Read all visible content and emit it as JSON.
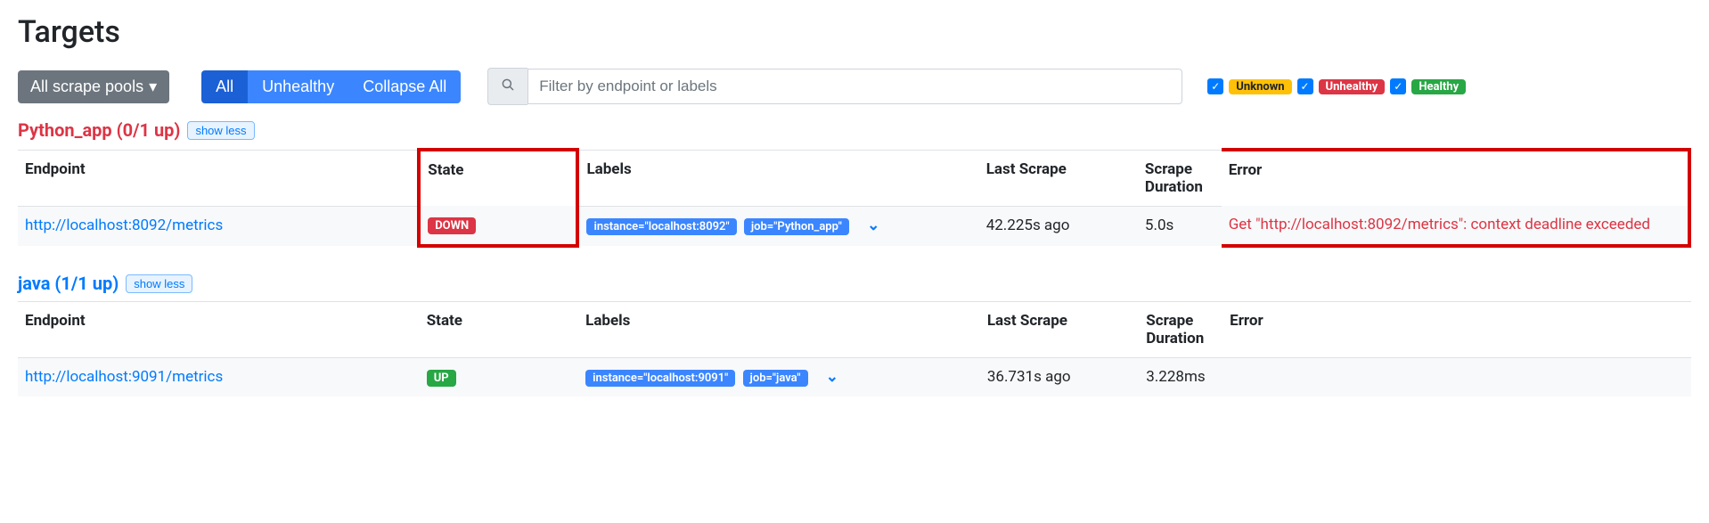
{
  "page_title": "Targets",
  "toolbar": {
    "pools": "All scrape pools",
    "all": "All",
    "unhealthy": "Unhealthy",
    "collapse": "Collapse All",
    "search_placeholder": "Filter by endpoint or labels"
  },
  "legend": {
    "unknown": "Unknown",
    "unhealthy": "Unhealthy",
    "healthy": "Healthy"
  },
  "headers": {
    "endpoint": "Endpoint",
    "state": "State",
    "labels": "Labels",
    "last_scrape": "Last Scrape",
    "duration": "Scrape Duration",
    "error": "Error"
  },
  "showless": "show less",
  "groups": {
    "python": {
      "title": "Python_app (0/1 up)",
      "endpoint": "http://localhost:8092/metrics",
      "state": "DOWN",
      "label_instance": "instance=\"localhost:8092\"",
      "label_job": "job=\"Python_app\"",
      "last_scrape": "42.225s ago",
      "duration": "5.0s",
      "error": "Get \"http://localhost:8092/metrics\": context deadline exceeded"
    },
    "java": {
      "title": "java (1/1 up)",
      "endpoint": "http://localhost:9091/metrics",
      "state": "UP",
      "label_instance": "instance=\"localhost:9091\"",
      "label_job": "job=\"java\"",
      "last_scrape": "36.731s ago",
      "duration": "3.228ms",
      "error": ""
    }
  }
}
